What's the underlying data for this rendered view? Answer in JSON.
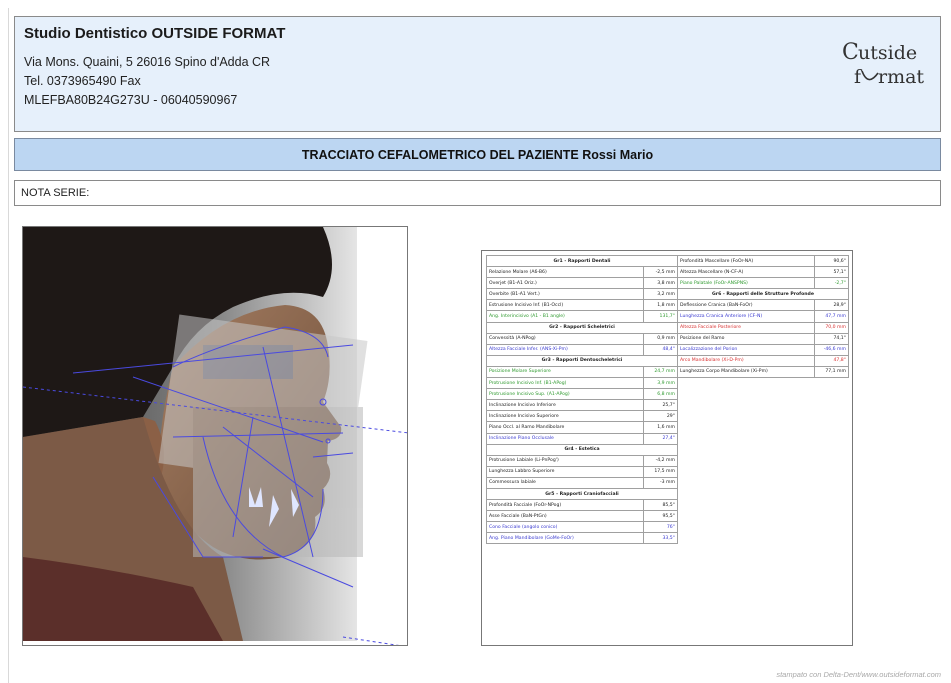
{
  "header": {
    "studio_name": "Studio Dentistico OUTSIDE FORMAT",
    "address": "Via Mons. Quaini, 5 26016 Spino d'Adda CR",
    "phone": "Tel. 0373965490 Fax",
    "tax_code": "MLEFBA80B24G273U - 06040590967",
    "logo_line1": "utside",
    "logo_line2": "rmat"
  },
  "title": "TRACCIATO CEFALOMETRICO DEL PAZIENTE Rossi Mario",
  "note_label": "NOTA SERIE:",
  "colors": {
    "header_bg": "#e6f0fb",
    "title_bg": "#bcd6f2",
    "tracing": "#4a4ae0"
  },
  "table_left": [
    {
      "label": "Gr1 - Rapporti Dentali",
      "header": true
    },
    {
      "label": "Relazione Molare (A6-B6)",
      "value": "-2,5 mm"
    },
    {
      "label": "Overjet (B1-A1 Oriz.)",
      "value": "3,8 mm"
    },
    {
      "label": "Overbite (B1-A1 Vert.)",
      "value": "3,2 mm"
    },
    {
      "label": "Estrusione Incisivo Inf. (B1-Occl)",
      "value": "1,8 mm"
    },
    {
      "label": "Ang. Interincisivo (A1 - B1 angle)",
      "value": "131,7°",
      "color": "green"
    },
    {
      "label": "Gr2 - Rapporti Scheletrici",
      "header": true
    },
    {
      "label": "Convessità (A-NPog)",
      "value": "0,9 mm"
    },
    {
      "label": "Altezza Facciale Infer. (ANS-Xi-Pm)",
      "value": "48,4°",
      "color": "blue"
    },
    {
      "label": "Gr3 - Rapporti Dentoscheletrici",
      "header": true
    },
    {
      "label": "Posizione Molare Superiore",
      "value": "24,7 mm",
      "color": "green"
    },
    {
      "label": "Protrusione Incisivo Inf. (B1-APog)",
      "value": "3,9 mm",
      "color": "green"
    },
    {
      "label": "Protrusione Incisivo Sup. (A1-APog)",
      "value": "6,8 mm",
      "color": "green"
    },
    {
      "label": "Inclinazione Incisivo Inferiore",
      "value": "25,7°"
    },
    {
      "label": "Inclinazione Incisivo Superiore",
      "value": "29°"
    },
    {
      "label": "Piano Occl. al Ramo Mandibolare",
      "value": "1,6 mm"
    },
    {
      "label": "Inclinazione Piano Occlusale",
      "value": "27,4°",
      "color": "blue"
    },
    {
      "label": "Gr4 - Estetica",
      "header": true
    },
    {
      "label": "Protrusione Labiale (Li-PnPog')",
      "value": "-4,2 mm"
    },
    {
      "label": "Lunghezza Labbro Superiore",
      "value": "17,5 mm"
    },
    {
      "label": "Commessura labiale",
      "value": "-3 mm"
    },
    {
      "label": "Gr5 - Rapporti Craniofacciali",
      "header": true
    },
    {
      "label": "Profondità Facciale (FoOr-NPog)",
      "value": "85,5°"
    },
    {
      "label": "Asse Facciale (BaN-PtGn)",
      "value": "95,5°"
    },
    {
      "label": "Cono Facciale (angolo conico)",
      "value": "76°",
      "color": "blue"
    },
    {
      "label": "Ang. Piano Mandibolare (GoMe-FoOr)",
      "value": "33,5°",
      "color": "blue"
    }
  ],
  "table_right": [
    {
      "label": "Profondità Mascellare (FoOr-NA)",
      "value": "90,6°"
    },
    {
      "label": "Altezza Mascellare (N-CF-A)",
      "value": "57,1°"
    },
    {
      "label": "Piano Palatale (FoOr-ANSPNS)",
      "value": "-2,7°",
      "color": "green"
    },
    {
      "label": "Gr6 - Rapporti delle Strutture Profonde",
      "header": true
    },
    {
      "label": "Deflessione Cranica (BaN-FoOr)",
      "value": "28,9°"
    },
    {
      "label": "Lunghezza Cranica Anteriore (CF-N)",
      "value": "47,7 mm",
      "color": "blue"
    },
    {
      "label": "Altezza Facciale Posteriore",
      "value": "70,0 mm",
      "color": "red"
    },
    {
      "label": "Posizione del Ramo",
      "value": "74,1°"
    },
    {
      "label": "Localizzazione del Porion",
      "value": "-46,6 mm",
      "color": "blue"
    },
    {
      "label": "Arco Mandibolare (Xi-D-Pm)",
      "value": "47,8°",
      "color": "red"
    },
    {
      "label": "Lunghezza Corpo Mandibolare (Xi-Pm)",
      "value": "77,1 mm"
    }
  ],
  "footer": "stampato con Delta-Dent/www.outsideformat.com"
}
